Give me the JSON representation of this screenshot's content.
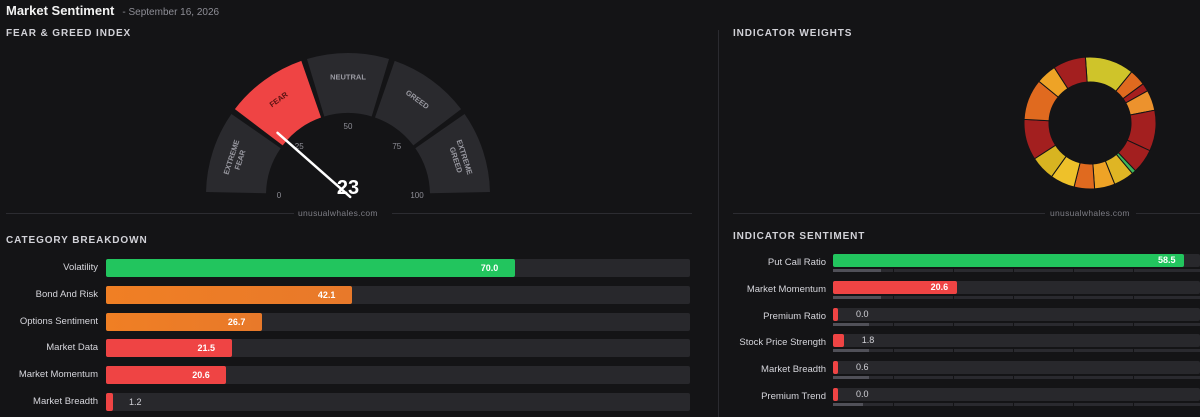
{
  "header": {
    "title": "Market Sentiment",
    "date": "- September 16, 2026"
  },
  "fear_greed": {
    "section_title": "FEAR & GREED INDEX",
    "value": 23,
    "zones": [
      "EXTREME FEAR",
      "FEAR",
      "NEUTRAL",
      "GREED",
      "EXTREME GREED"
    ],
    "scale_labels": [
      "0",
      "25",
      "50",
      "75",
      "100"
    ],
    "active_zone_color": "#ef4444",
    "inactive_zone_color": "#2a2a2e",
    "brand": "unusualwhales.com"
  },
  "indicator_weights": {
    "section_title": "INDICATOR WEIGHTS",
    "brand": "unusualwhales.com",
    "segments": [
      {
        "value": 12,
        "color": "#cfc42a"
      },
      {
        "value": 4,
        "color": "#e06a1f"
      },
      {
        "value": 2,
        "color": "#a61e1e"
      },
      {
        "value": 5,
        "color": "#ec922d"
      },
      {
        "value": 10,
        "color": "#a31f1f"
      },
      {
        "value": 6,
        "color": "#a31f1f"
      },
      {
        "value": 1,
        "color": "#3eb55a"
      },
      {
        "value": 5,
        "color": "#dfb524"
      },
      {
        "value": 5,
        "color": "#eea326"
      },
      {
        "value": 5,
        "color": "#e06a1f"
      },
      {
        "value": 6,
        "color": "#eec12a"
      },
      {
        "value": 6,
        "color": "#d8b421"
      },
      {
        "value": 10,
        "color": "#a31f1f"
      },
      {
        "value": 10,
        "color": "#e06a1f"
      },
      {
        "value": 5,
        "color": "#eea326"
      },
      {
        "value": 8,
        "color": "#a31f1f"
      }
    ]
  },
  "category_breakdown": {
    "section_title": "CATEGORY BREAKDOWN",
    "items": [
      {
        "label": "Volatility",
        "value": 70.0,
        "display": "70.0",
        "color": "#22c55e"
      },
      {
        "label": "Bond And Risk",
        "value": 42.1,
        "display": "42.1",
        "color": "#f07f24"
      },
      {
        "label": "Options Sentiment",
        "value": 26.7,
        "display": "26.7",
        "color": "#f07f24"
      },
      {
        "label": "Market Data",
        "value": 21.5,
        "display": "21.5",
        "color": "#ef4444"
      },
      {
        "label": "Market Momentum",
        "value": 20.6,
        "display": "20.6",
        "color": "#ef4444"
      },
      {
        "label": "Market Breadth",
        "value": 1.2,
        "display": "1.2",
        "color": "#ef4444"
      }
    ]
  },
  "indicator_sentiment": {
    "section_title": "INDICATOR SENTIMENT",
    "items": [
      {
        "label": "Put Call Ratio",
        "value": 58.5,
        "display": "58.5",
        "color": "#22c55e",
        "weight": 0.08
      },
      {
        "label": "Market Momentum",
        "value": 20.6,
        "display": "20.6",
        "color": "#ef4444",
        "weight": 0.08
      },
      {
        "label": "Premium Ratio",
        "value": 0.0,
        "display": "0.0",
        "color": "#ef4444",
        "weight": 0.06
      },
      {
        "label": "Stock Price Strength",
        "value": 1.8,
        "display": "1.8",
        "color": "#ef4444",
        "weight": 0.06
      },
      {
        "label": "Market Breadth",
        "value": 0.6,
        "display": "0.6",
        "color": "#ef4444",
        "weight": 0.06
      },
      {
        "label": "Premium Trend",
        "value": 0.0,
        "display": "0.0",
        "color": "#ef4444",
        "weight": 0.05
      }
    ]
  }
}
